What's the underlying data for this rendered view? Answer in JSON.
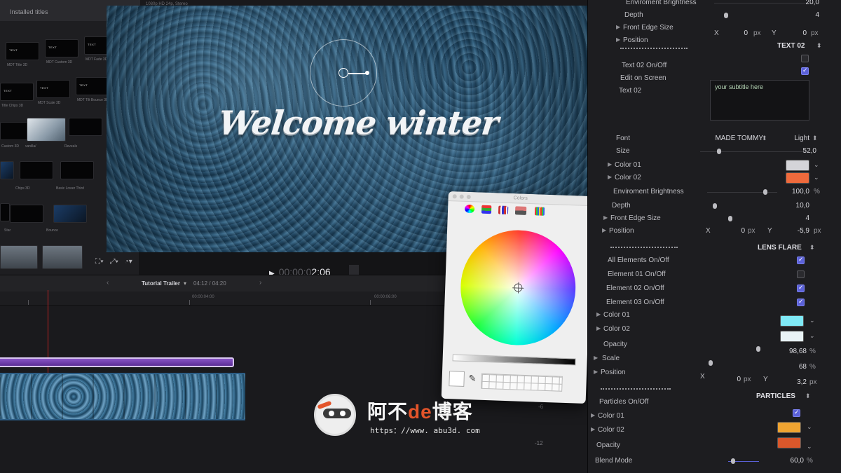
{
  "browser": {
    "header": "Installed titles",
    "tiles": [
      {
        "text": "TEXT",
        "label": "MDT Title 3D"
      },
      {
        "text": "TEXT",
        "label": "MDT Custom 3D"
      },
      {
        "text": "TEXT",
        "label": "MDT Fade 3D"
      },
      {
        "text": "TEXT",
        "label": "Title Chips 3D"
      },
      {
        "text": "TEXT",
        "label": "MDT Scale 3D"
      },
      {
        "text": "TEXT",
        "label": "MDT Tilt Bounce 3D"
      },
      {
        "text": "",
        "label": "Custom 3D"
      },
      {
        "text": "",
        "label": "vanilla/"
      },
      {
        "text": "",
        "label": "Reveals"
      },
      {
        "text": "",
        "label": "Chips 3D"
      },
      {
        "text": "",
        "label": "Basic Lower Third"
      },
      {
        "text": "",
        "label": "Star"
      },
      {
        "text": "",
        "label": "Bounce"
      }
    ]
  },
  "viewer": {
    "top_info": "1080p HD 24p, Stereo",
    "title_text": "Welcome winter",
    "timecode_dim": "00:00:0",
    "timecode": "2:06",
    "tools_icons": [
      "crop-icon",
      "transform-icon",
      "speed-icon"
    ]
  },
  "timeline": {
    "project_name": "Tutorial Trailer",
    "duration": "04:12 / 04:20",
    "ruler": [
      "00:00:04:00",
      "00:00:06:00"
    ],
    "meter": [
      "-6",
      "-12"
    ]
  },
  "colors_panel": {
    "title": "Colors",
    "tabs": [
      "color-wheel-tab",
      "sliders-tab",
      "palettes-tab",
      "image-palettes-tab",
      "pencils-tab"
    ]
  },
  "inspector": {
    "rows_top": [
      {
        "label": "Enviroment Brightness",
        "value": "20,0"
      },
      {
        "label": "Depth",
        "value": "4"
      },
      {
        "label": "Front Edge Size",
        "value": "",
        "x": "0",
        "y": "0",
        "unit": "px"
      },
      {
        "label": "Position",
        "value": ""
      }
    ],
    "text02_section": "TEXT 02",
    "text02_onoff": "Text 02 On/Off",
    "edit_on_screen": "Edit on Screen",
    "text02_label": "Text 02",
    "text02_value": "your subtitle here",
    "font_label": "Font",
    "font_value": "MADE TOMMY",
    "font_weight": "Light",
    "size_label": "Size",
    "size_value": "52,0",
    "color01_label": "Color 01",
    "color01": "#d4d4d8",
    "color02_label": "Color 02",
    "color02": "#ef6a3c",
    "env_label": "Enviroment Brightness",
    "env_value": "100,0",
    "env_unit": "%",
    "depth_label": "Depth",
    "depth_value": "10,0",
    "fes_label": "Front Edge Size",
    "fes_value": "4",
    "pos_label": "Position",
    "pos_x_label": "X",
    "pos_x": "0",
    "pos_y_label": "Y",
    "pos_y": "-5,9",
    "px": "px",
    "lens_section": "LENS FLARE",
    "lens_all": "All Elements On/Off",
    "lens_e1": "Element 01 On/Off",
    "lens_e2": "Element 02 On/Off",
    "lens_e3": "Element 03 On/Off",
    "lens_color01_label": "Color 01",
    "lens_color01": "#7fe9f6",
    "lens_color02_label": "Color 02",
    "lens_color02": "#e9f3f6",
    "lens_opacity_label": "Opacity",
    "lens_opacity": "98,68",
    "lens_scale_label": "Scale",
    "lens_scale": "68",
    "lens_pos_label": "Position",
    "lens_pos_x": "0",
    "lens_pos_y": "3,2",
    "particles_section": "PARTICLES",
    "particles_onoff": "Particles On/Off",
    "p_color01_label": "Color 01",
    "p_color01": "#f0a431",
    "p_color02_label": "Color 02",
    "p_color02": "#d9572b",
    "p_opacity_label": "Opacity",
    "p_blend_label": "Blend Mode",
    "p_blend_value": "60,0",
    "percent": "%"
  },
  "watermark": {
    "title_a": "阿不",
    "title_b": "de",
    "title_c": "博客",
    "url": "https：//www. abu3d. com"
  }
}
